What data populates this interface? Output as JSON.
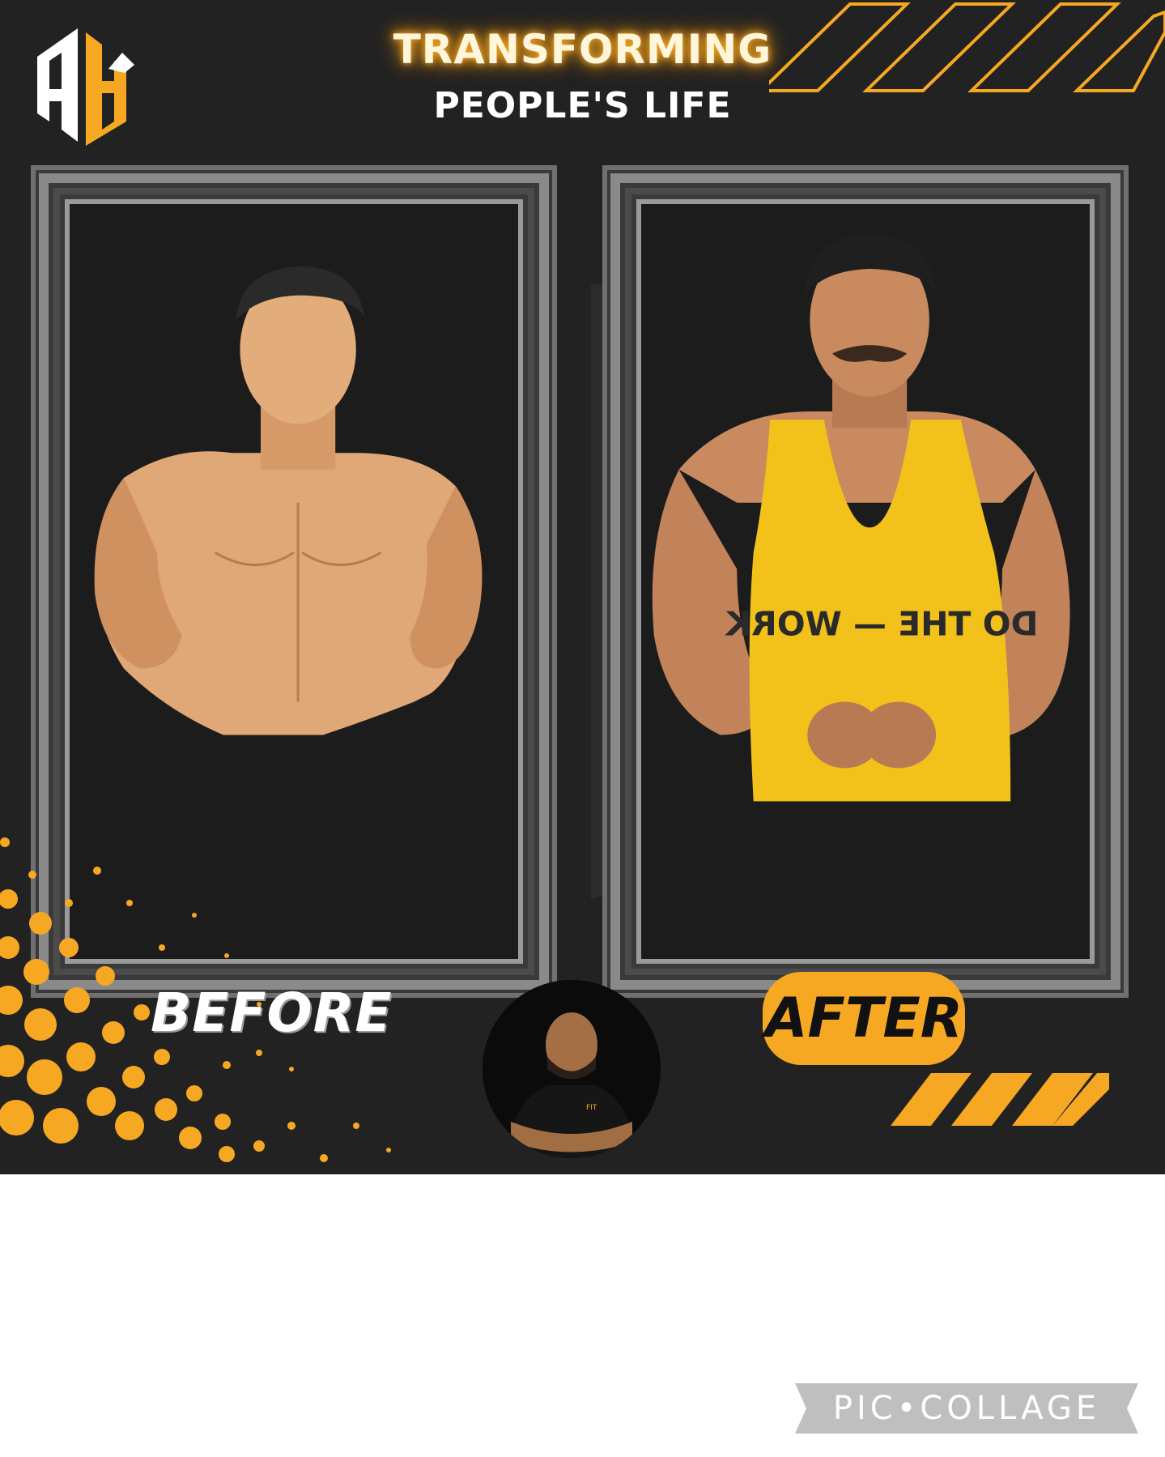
{
  "poster": {
    "title": "TRANSFORMING",
    "subtitle": "PEOPLE'S LIFE",
    "logo_letters": "AH",
    "before_label": "BEFORE",
    "after_label": "AFTER",
    "shirt_text": "DO THE — WORK"
  },
  "watermark": {
    "text": "PIC•COLLAGE"
  },
  "colors": {
    "background": "#222222",
    "accent_orange": "#f7a823",
    "frame_silver": "#8a8a8a",
    "text_white": "#ffffff"
  }
}
